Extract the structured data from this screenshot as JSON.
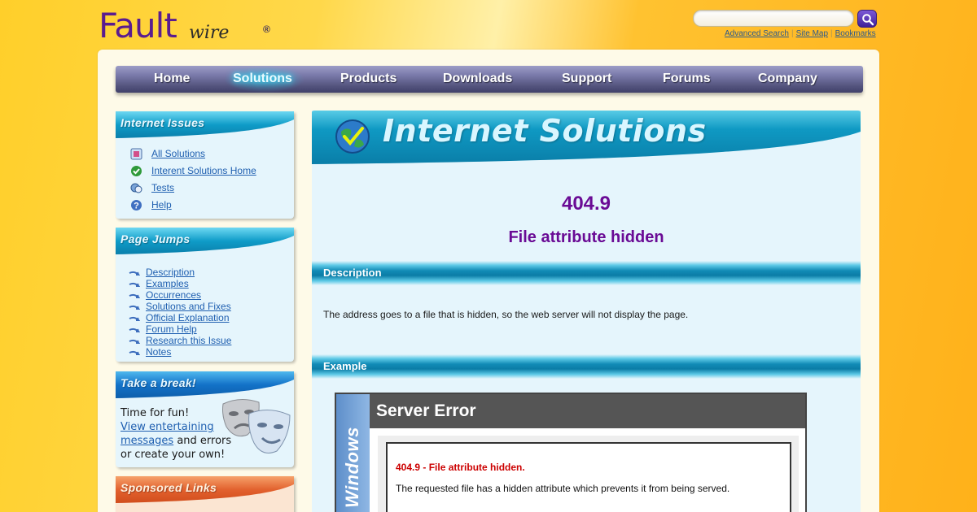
{
  "header": {
    "logo_main": "Fault",
    "logo_script": "wire",
    "logo_reg": "®",
    "search": {
      "value": "",
      "placeholder": ""
    },
    "links": [
      "Advanced Search",
      "Site Map",
      "Bookmarks"
    ]
  },
  "nav": {
    "items": [
      "Home",
      "Solutions",
      "Products",
      "Downloads",
      "Support",
      "Forums",
      "Company"
    ],
    "active": "Solutions"
  },
  "sidebar": {
    "internet_issues": {
      "title": "Internet Issues",
      "items": [
        {
          "label": "All Solutions",
          "icon": "solutions-list-icon"
        },
        {
          "label": "Interent Solutions Home",
          "icon": "green-check-icon"
        },
        {
          "label": "Tests",
          "icon": "tests-icon"
        },
        {
          "label": "Help",
          "icon": "help-icon"
        }
      ]
    },
    "page_jumps": {
      "title": "Page Jumps",
      "items": [
        "Description",
        "Examples",
        "Occurrences",
        "Solutions and Fixes",
        "Official Explanation",
        "Forum Help",
        "Research this Issue",
        "Notes"
      ]
    },
    "take_a_break": {
      "title": "Take a break!",
      "line1": "Time for fun!",
      "link": "View entertaining messages",
      "line2": "and errors or create your own!"
    },
    "sponsored": {
      "title": "Sponsored Links"
    }
  },
  "main": {
    "title": "Internet Solutions",
    "error_code": "404.9",
    "error_name": "File attribute hidden",
    "sections": {
      "description_label": "Description",
      "description_text": "The address goes to a file that is hidden, so the web server will not display the page.",
      "example_label": "Example"
    },
    "example_window": {
      "side_label": "Windows",
      "title": "Server Error",
      "heading": "404.9 - File attribute hidden.",
      "body": "The requested file has a hidden attribute which prevents it from being served."
    }
  },
  "colors": {
    "accent_purple": "#6a0b95",
    "section_teal": "#128bb6",
    "link_blue": "#1f5fb0",
    "error_red": "#cc0000"
  }
}
